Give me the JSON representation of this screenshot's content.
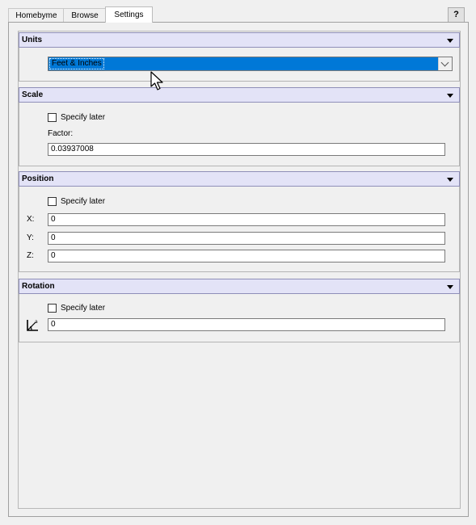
{
  "tabs": [
    {
      "label": "Homebyme",
      "active": false
    },
    {
      "label": "Browse",
      "active": false
    },
    {
      "label": "Settings",
      "active": true
    }
  ],
  "help_label": "?",
  "units": {
    "title": "Units",
    "selected_value": "Feet & Inches"
  },
  "scale": {
    "title": "Scale",
    "specify_later_label": "Specify later",
    "specify_later_checked": false,
    "factor_label": "Factor:",
    "factor_value": "0.03937008"
  },
  "position": {
    "title": "Position",
    "specify_later_label": "Specify later",
    "specify_later_checked": false,
    "x_label": "X:",
    "x_value": "0",
    "y_label": "Y:",
    "y_value": "0",
    "z_label": "Z:",
    "z_value": "0"
  },
  "rotation": {
    "title": "Rotation",
    "specify_later_label": "Specify later",
    "specify_later_checked": false,
    "value": "0",
    "icon": "rotate-axis-icon"
  },
  "colors": {
    "section_header_bg": "#e3e3f7",
    "selection_blue": "#0078d7"
  }
}
